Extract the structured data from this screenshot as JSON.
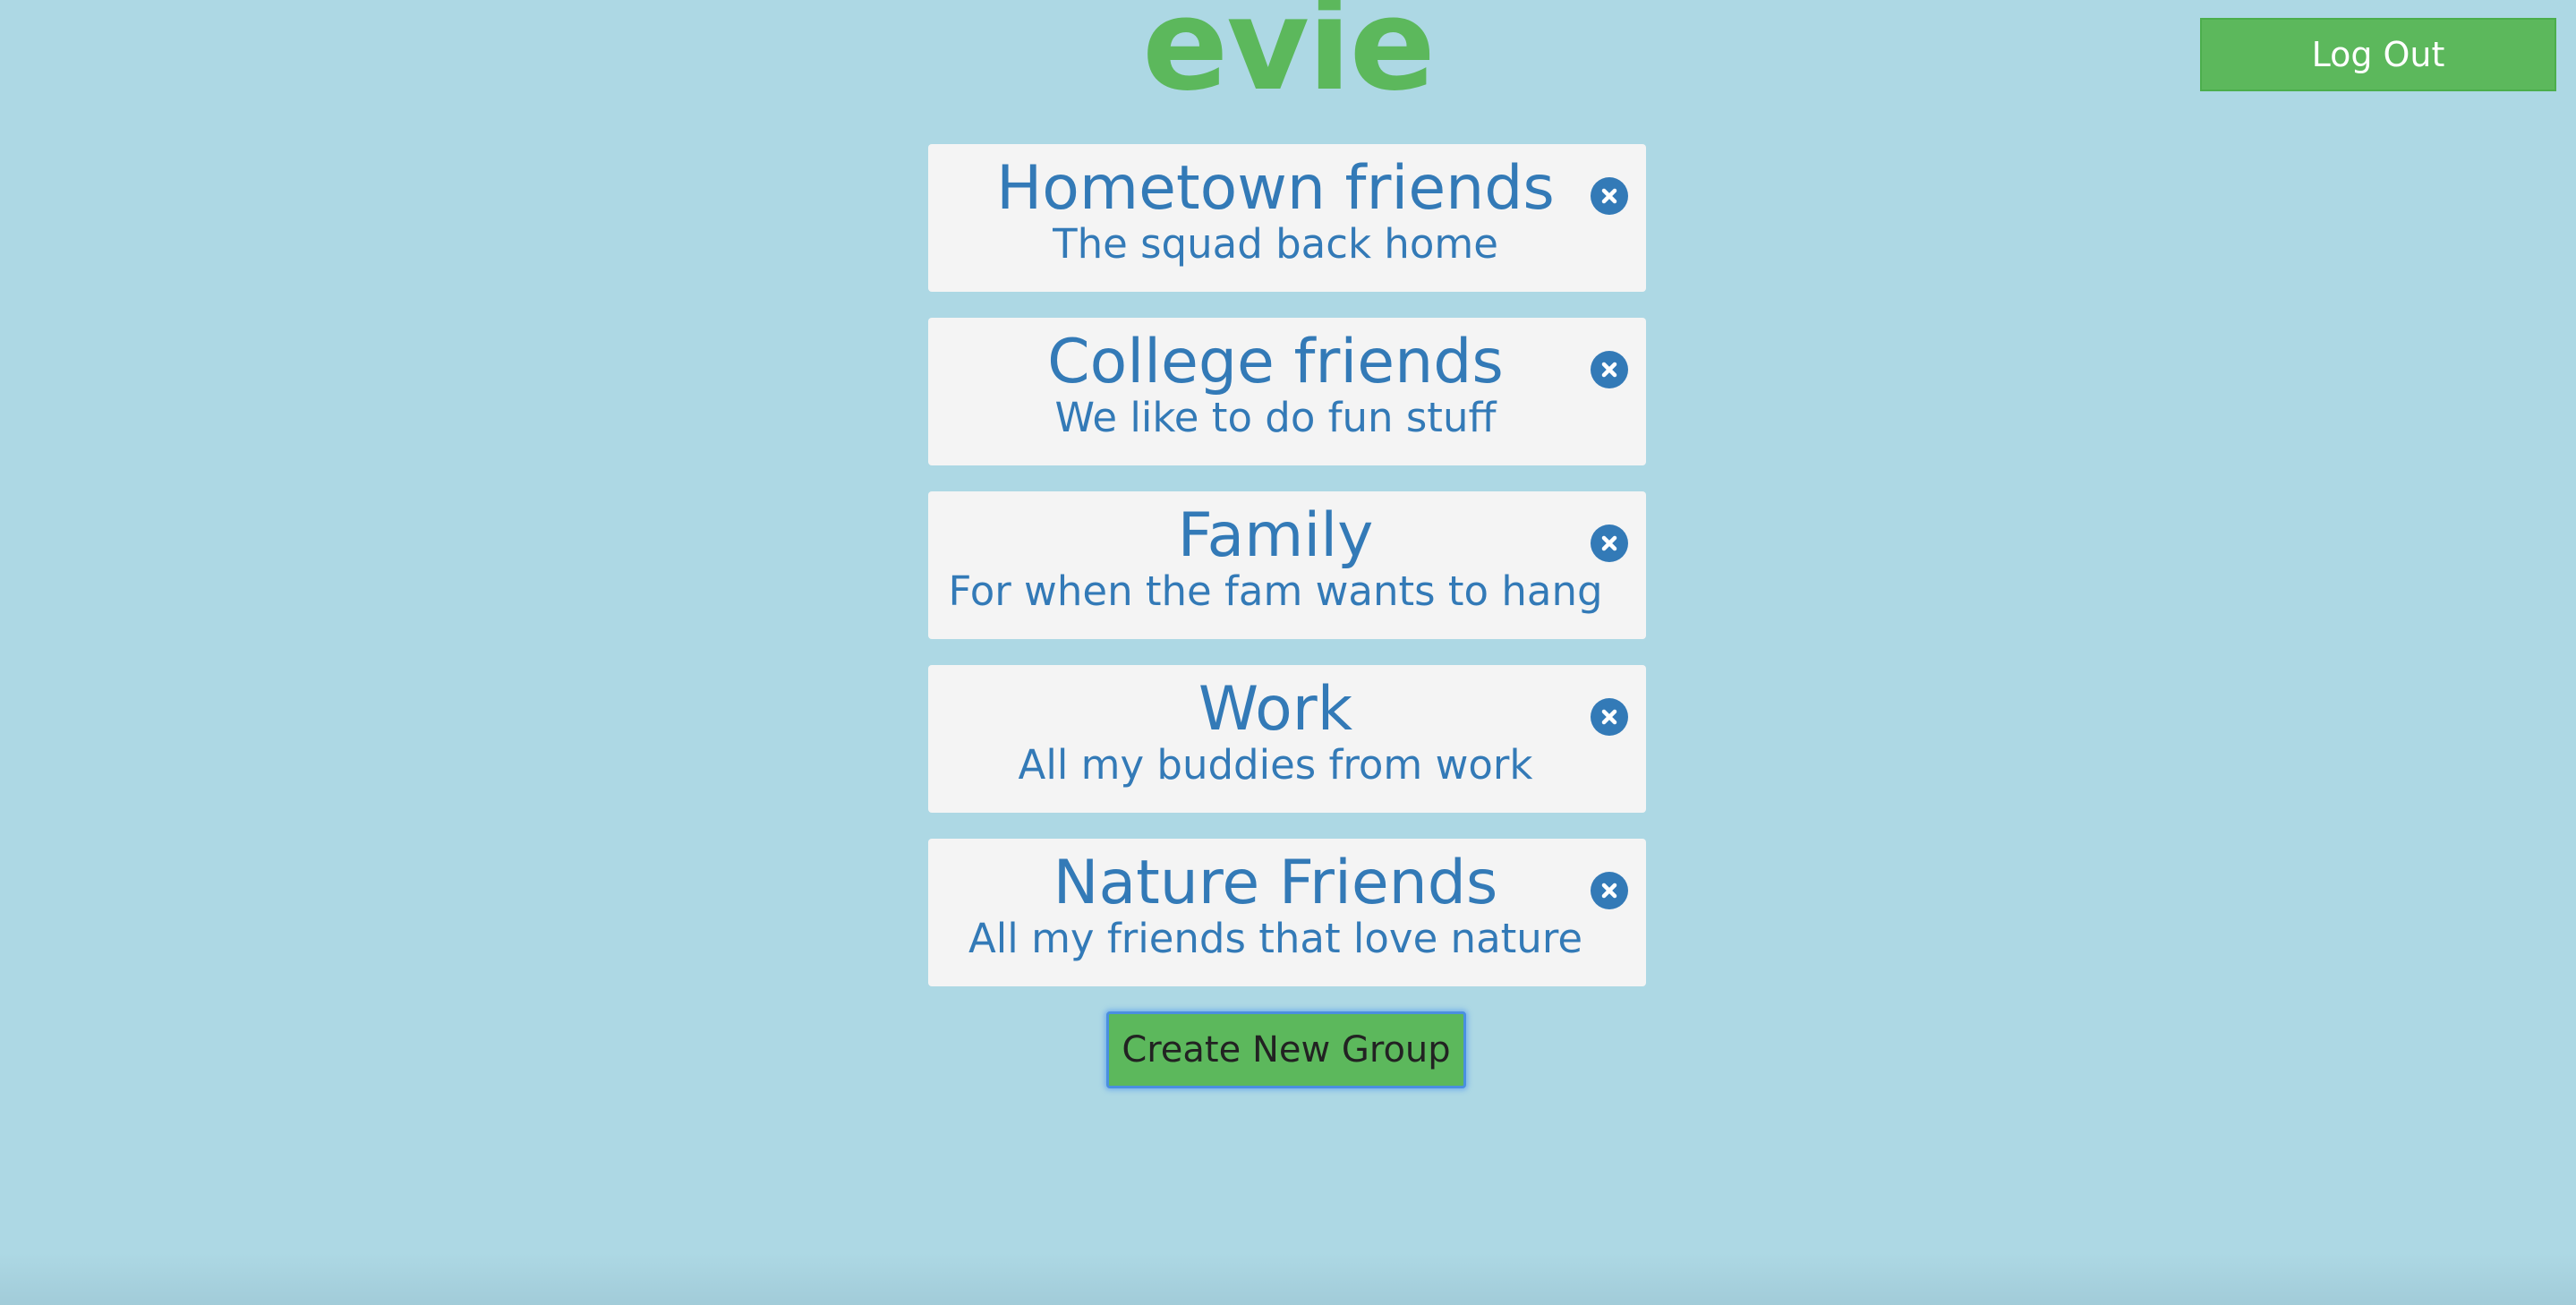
{
  "app": {
    "logo_text": "evie"
  },
  "header": {
    "logout_label": "Log Out"
  },
  "groups": [
    {
      "name": "Hometown friends",
      "description": "The squad back home"
    },
    {
      "name": "College friends",
      "description": "We like to do fun stuff"
    },
    {
      "name": "Family",
      "description": "For when the fam wants to hang"
    },
    {
      "name": "Work",
      "description": "All my buddies from work"
    },
    {
      "name": "Nature Friends",
      "description": "All my friends that love nature"
    }
  ],
  "actions": {
    "create_group_label": "Create New Group"
  },
  "icons": {
    "remove": "remove-circle-icon"
  },
  "colors": {
    "background": "#add8e4",
    "brand_green": "#5cb85c",
    "card_background": "#f4f4f4",
    "text_blue": "#337ab7"
  }
}
